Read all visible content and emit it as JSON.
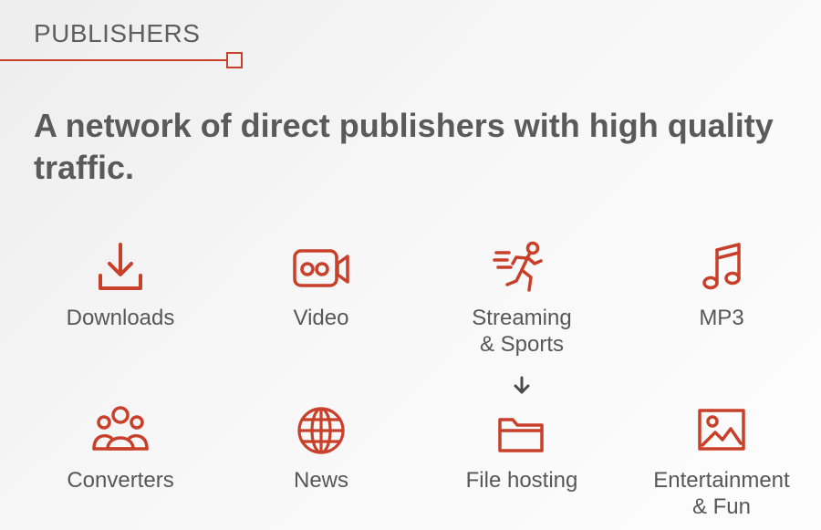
{
  "section": {
    "label": "PUBLISHERS"
  },
  "headline": "A network of direct publishers with high quality traffic.",
  "colors": {
    "accent": "#c9402a",
    "text": "#575757",
    "heading": "#5a5a5a"
  },
  "categories": [
    {
      "label": "Downloads",
      "icon": "download-icon"
    },
    {
      "label": "Video",
      "icon": "video-camera-icon"
    },
    {
      "label": "Streaming\n& Sports",
      "icon": "runner-icon"
    },
    {
      "label": "MP3",
      "icon": "music-note-icon"
    },
    {
      "label": "Converters",
      "icon": "group-icon"
    },
    {
      "label": "News",
      "icon": "globe-icon"
    },
    {
      "label": "File hosting",
      "icon": "folder-download-icon"
    },
    {
      "label": "Entertainment\n& Fun",
      "icon": "picture-icon"
    }
  ]
}
